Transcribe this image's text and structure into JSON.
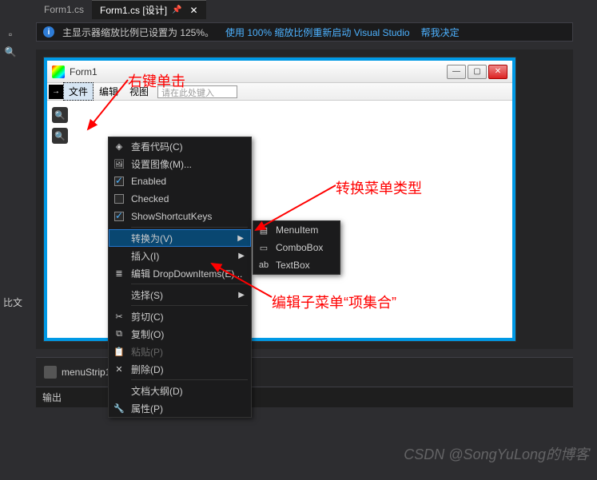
{
  "tabs": [
    {
      "label": "Form1.cs"
    },
    {
      "label": "Form1.cs [设计]"
    }
  ],
  "notification": {
    "message": "主显示器缩放比例已设置为 125%。",
    "link1": "使用 100% 缩放比例重新启动 Visual Studio",
    "link2": "帮我决定"
  },
  "form": {
    "title": "Form1",
    "menu": {
      "file": "文件",
      "edit": "编辑",
      "view": "视图",
      "placeholder": "请在此处键入"
    }
  },
  "context_menu": {
    "view_code": "查看代码(C)",
    "set_image": "设置图像(M)...",
    "enabled": "Enabled",
    "checked": "Checked",
    "show_shortcut": "ShowShortcutKeys",
    "convert_to": "转换为(V)",
    "insert": "插入(I)",
    "edit_dropdown": "编辑 DropDownItems(E)...",
    "select": "选择(S)",
    "cut": "剪切(C)",
    "copy": "复制(O)",
    "paste": "粘贴(P)",
    "delete": "删除(D)",
    "doc_outline": "文档大纲(D)",
    "properties": "属性(P)"
  },
  "submenu": {
    "menuitem": "MenuItem",
    "combobox": "ComboBox",
    "textbox": "TextBox"
  },
  "annotations": {
    "right_click": "右键单击",
    "convert_type": "转换菜单类型",
    "edit_collection": "编辑子菜单“项集合”"
  },
  "tray": {
    "name": "menuStrip1"
  },
  "output": {
    "label": "输出"
  },
  "sidebar_text": "比文",
  "watermark": "CSDN @SongYuLong的博客"
}
